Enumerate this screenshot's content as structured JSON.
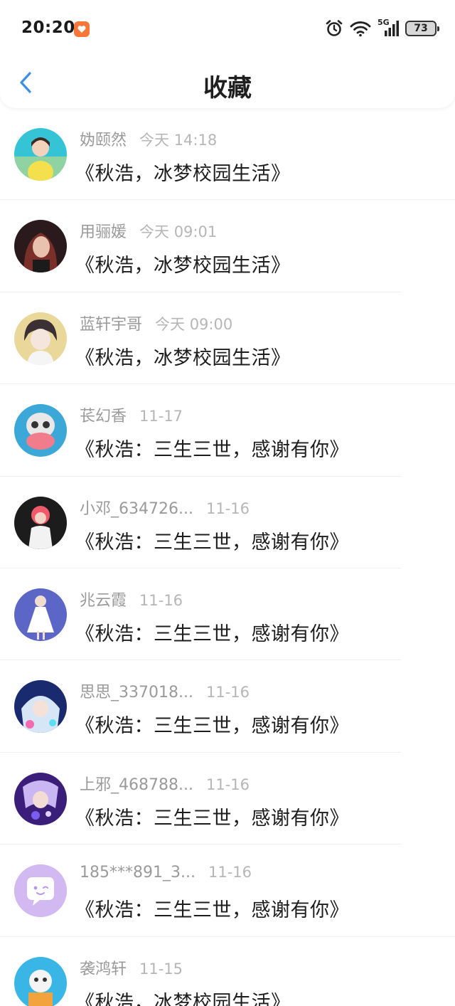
{
  "status_bar": {
    "time": "20:20",
    "network": "5G",
    "battery": "73"
  },
  "header": {
    "title": "收藏"
  },
  "items": [
    {
      "name": "妫颐然",
      "time": "今天 14:18",
      "title": "《秋浩，冰梦校园生活》",
      "avatar": "girl-yellow-shirt"
    },
    {
      "name": "用骊媛",
      "time": "今天 09:01",
      "title": "《秋浩，冰梦校园生活》",
      "avatar": "girl-dark-hair"
    },
    {
      "name": "蓝轩宇哥",
      "time": "今天 09:00",
      "title": "《秋浩，冰梦校园生活》",
      "avatar": "anime-boy"
    },
    {
      "name": "苌幻香",
      "time": "11-17",
      "title": "《秋浩：三生三世，感谢有你》",
      "avatar": "skull-art"
    },
    {
      "name": "小邓_634726...",
      "time": "11-16",
      "title": "《秋浩：三生三世，感谢有你》",
      "avatar": "pink-hair-figure"
    },
    {
      "name": "兆云霞",
      "time": "11-16",
      "title": "《秋浩：三生三世，感谢有你》",
      "avatar": "white-dress-dancer"
    },
    {
      "name": "思思_337018...",
      "time": "11-16",
      "title": "《秋浩：三生三世，感谢有你》",
      "avatar": "anime-blue-girl"
    },
    {
      "name": "上邪_468788...",
      "time": "11-16",
      "title": "《秋浩：三生三世，感谢有你》",
      "avatar": "purple-anime"
    },
    {
      "name": "185***891_3...",
      "time": "11-16",
      "title": "《秋浩：三生三世，感谢有你》",
      "avatar": "default-chat-icon"
    },
    {
      "name": "袭鸿轩",
      "time": "11-15",
      "title": "《秋浩，冰梦校园生活》",
      "avatar": "blue-cartoon"
    }
  ],
  "colors": {
    "accent": "#3a8ee6",
    "name_text": "#9a9a9a",
    "time_text": "#b6b6b6",
    "title_text": "#1d1d1d",
    "default_avatar_bg": "#cfb6f0"
  }
}
